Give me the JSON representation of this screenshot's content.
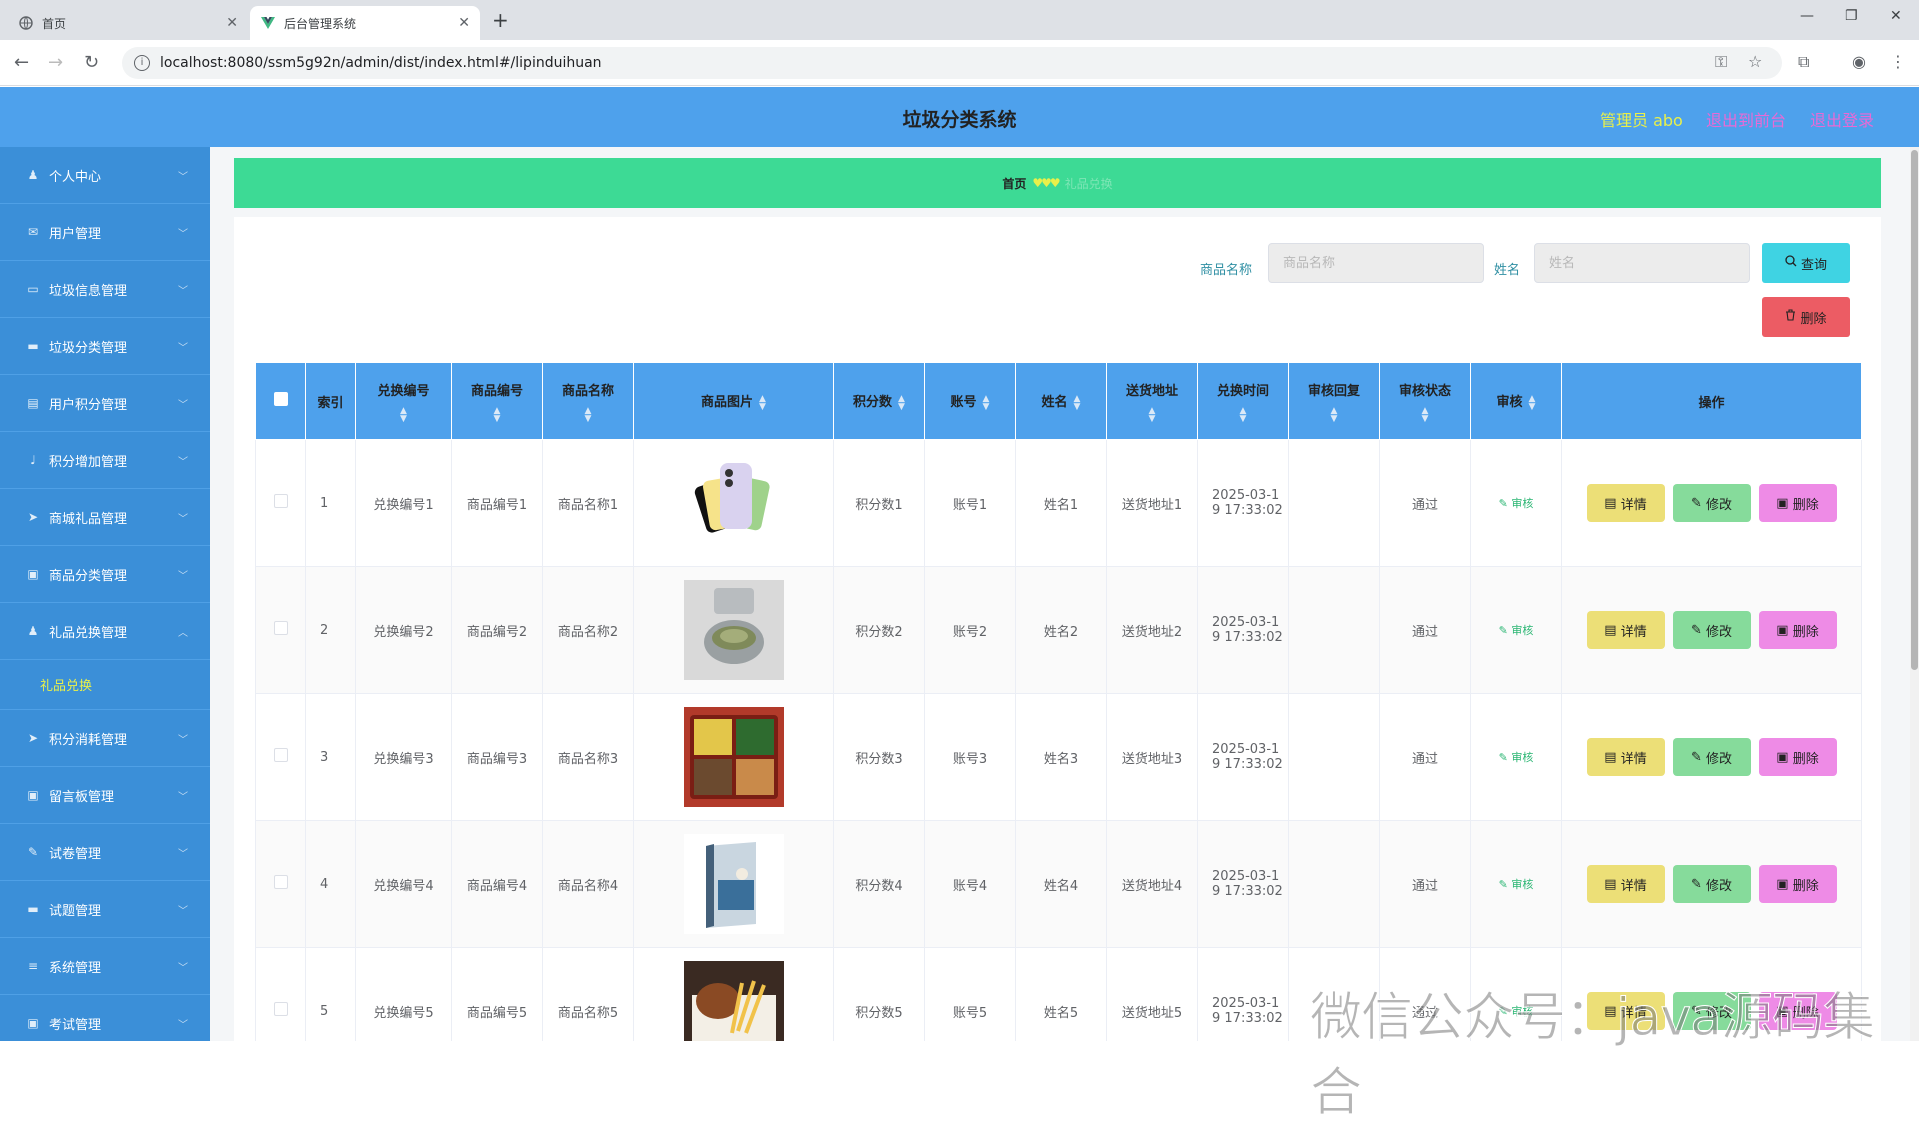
{
  "browser": {
    "tabs": [
      {
        "title": "首页"
      },
      {
        "title": "后台管理系统"
      }
    ],
    "url": "localhost:8080/ssm5g92n/admin/dist/index.html#/lipinduihuan"
  },
  "header": {
    "title": "垃圾分类系统",
    "admin": "管理员 abo",
    "to_front": "退出到前台",
    "logout": "退出登录"
  },
  "sidebar": {
    "items": [
      {
        "label": "个人中心",
        "icon": "user-icon"
      },
      {
        "label": "用户管理",
        "icon": "mail-icon"
      },
      {
        "label": "垃圾信息管理",
        "icon": "chat-icon"
      },
      {
        "label": "垃圾分类管理",
        "icon": "message-icon"
      },
      {
        "label": "用户积分管理",
        "icon": "document-icon"
      },
      {
        "label": "积分增加管理",
        "icon": "microphone-icon"
      },
      {
        "label": "商城礼品管理",
        "icon": "send-icon"
      },
      {
        "label": "商品分类管理",
        "icon": "trash-icon"
      },
      {
        "label": "礼品兑换管理",
        "icon": "user-icon"
      },
      {
        "label": "积分消耗管理",
        "icon": "send-icon"
      },
      {
        "label": "留言板管理",
        "icon": "trash-icon"
      },
      {
        "label": "试卷管理",
        "icon": "edit-icon"
      },
      {
        "label": "试题管理",
        "icon": "message-icon"
      },
      {
        "label": "系统管理",
        "icon": "menu-icon"
      },
      {
        "label": "考试管理",
        "icon": "trash-icon"
      }
    ],
    "active_sub": "礼品兑换"
  },
  "breadcrumb": {
    "home": "首页",
    "current": "礼品兑换"
  },
  "search": {
    "product_label": "商品名称",
    "product_placeholder": "商品名称",
    "name_label": "姓名",
    "name_placeholder": "姓名",
    "query_btn": "查询",
    "delete_btn": "删除"
  },
  "table": {
    "headers": [
      "索引",
      "兑换编号",
      "商品编号",
      "商品名称",
      "商品图片",
      "积分数",
      "账号",
      "姓名",
      "送货地址",
      "兑换时间",
      "审核回复",
      "审核状态",
      "审核",
      "操作"
    ],
    "rows": [
      {
        "index": "1",
        "code": "兑换编号1",
        "pcode": "商品编号1",
        "pname": "商品名称1",
        "image": "phone",
        "points": "积分数1",
        "account": "账号1",
        "name": "姓名1",
        "address": "送货地址1",
        "time": "2025-03-1\n9 17:33:02",
        "reply": "",
        "status": "通过",
        "audit": "审核"
      },
      {
        "index": "2",
        "code": "兑换编号2",
        "pcode": "商品编号2",
        "pname": "商品名称2",
        "image": "tea",
        "points": "积分数2",
        "account": "账号2",
        "name": "姓名2",
        "address": "送货地址2",
        "time": "2025-03-1\n9 17:33:02",
        "reply": "",
        "status": "通过",
        "audit": "审核"
      },
      {
        "index": "3",
        "code": "兑换编号3",
        "pcode": "商品编号3",
        "pname": "商品名称3",
        "image": "bento",
        "points": "积分数3",
        "account": "账号3",
        "name": "姓名3",
        "address": "送货地址3",
        "time": "2025-03-1\n9 17:33:02",
        "reply": "",
        "status": "通过",
        "audit": "审核"
      },
      {
        "index": "4",
        "code": "兑换编号4",
        "pcode": "商品编号4",
        "pname": "商品名称4",
        "image": "book",
        "points": "积分数4",
        "account": "账号4",
        "name": "姓名4",
        "address": "送货地址4",
        "time": "2025-03-1\n9 17:33:02",
        "reply": "",
        "status": "通过",
        "audit": "审核"
      },
      {
        "index": "5",
        "code": "兑换编号5",
        "pcode": "商品编号5",
        "pname": "商品名称5",
        "image": "fries",
        "points": "积分数5",
        "account": "账号5",
        "name": "姓名5",
        "address": "送货地址5",
        "time": "2025-03-1\n9 17:33:02",
        "reply": "",
        "status": "通过",
        "audit": "审核"
      }
    ],
    "actions": {
      "detail": "详情",
      "edit": "修改",
      "delete": "删除"
    }
  },
  "watermark": "微信公众号：java源码集合",
  "colors": {
    "header": "#4ea1ec",
    "sidebar": "#3b8fd8",
    "breadcrumb": "#3dda95",
    "query": "#3fd3e3",
    "danger": "#ec5c64"
  }
}
